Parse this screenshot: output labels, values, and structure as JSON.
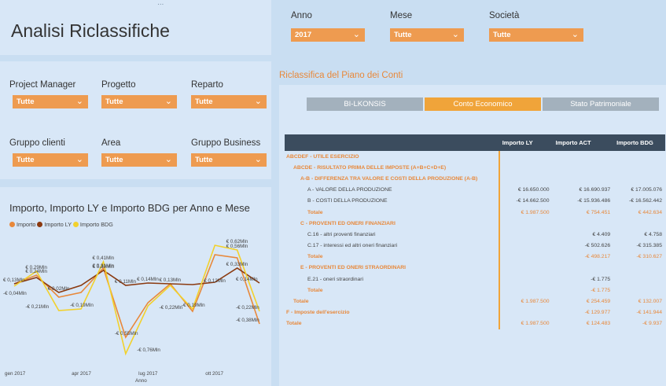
{
  "header": {
    "title": "Analisi Riclassifiche",
    "menu_dots": "∙∙∙"
  },
  "top_filters": [
    {
      "label": "Anno",
      "value": "2017"
    },
    {
      "label": "Mese",
      "value": "Tutte"
    },
    {
      "label": "Società",
      "value": "Tutte"
    }
  ],
  "side_filters": [
    {
      "label": "Project Manager",
      "value": "Tutte"
    },
    {
      "label": "Progetto",
      "value": "Tutte"
    },
    {
      "label": "Reparto",
      "value": "Tutte"
    },
    {
      "label": "Gruppo clienti",
      "value": "Tutte"
    },
    {
      "label": "Area",
      "value": "Tutte"
    },
    {
      "label": "Gruppo Business",
      "value": "Tutte"
    }
  ],
  "section_title": "Riclassifica del Piano dei Conti",
  "tabs": [
    {
      "label": "BI-LKONSIS",
      "active": false
    },
    {
      "label": "Conto Economico",
      "active": true
    },
    {
      "label": "Stato Patrimoniale",
      "active": false
    }
  ],
  "table": {
    "columns": [
      "",
      "Importo LY",
      "Importo ACT",
      "Importo BDG"
    ],
    "rows": [
      {
        "label": "ABCDEF - UTILE ESERCIZIO",
        "indent": 0,
        "style": "orange",
        "ly": "",
        "act": "",
        "bdg": ""
      },
      {
        "label": "ABCDE - RISULTATO PRIMA DELLE IMPOSTE (A+B+C+D+E)",
        "indent": 1,
        "style": "orange",
        "ly": "",
        "act": "",
        "bdg": ""
      },
      {
        "label": "A-B - DIFFERENZA TRA VALORE E COSTI DELLA PRODUZIONE (A-B)",
        "indent": 2,
        "style": "orange",
        "ly": "",
        "act": "",
        "bdg": ""
      },
      {
        "label": "A - VALORE DELLA PRODUZIONE",
        "indent": 3,
        "style": "normal",
        "ly": "€ 16.650.000",
        "act": "€ 16.690.937",
        "bdg": "€ 17.005.076"
      },
      {
        "label": "B - COSTI DELLA PRODUZIONE",
        "indent": 3,
        "style": "normal",
        "ly": "-€ 14.662.500",
        "act": "-€ 15.936.486",
        "bdg": "-€ 16.562.442"
      },
      {
        "label": "Totale",
        "indent": 3,
        "style": "orange",
        "ly": "€ 1.987.500",
        "act": "€ 754.451",
        "bdg": "€ 442.634"
      },
      {
        "label": "C - PROVENTI ED ONERI FINANZIARI",
        "indent": 2,
        "style": "orange",
        "ly": "",
        "act": "",
        "bdg": ""
      },
      {
        "label": "C.16 - altri proventi finanziari",
        "indent": 3,
        "style": "normal",
        "ly": "",
        "act": "€ 4.409",
        "bdg": "€ 4.758"
      },
      {
        "label": "C.17 - interessi ed altri oneri finanziari",
        "indent": 3,
        "style": "normal",
        "ly": "",
        "act": "-€ 502.626",
        "bdg": "-€ 315.385"
      },
      {
        "label": "Totale",
        "indent": 3,
        "style": "orange",
        "ly": "",
        "act": "-€ 498.217",
        "bdg": "-€ 310.627"
      },
      {
        "label": "E - PROVENTI ED ONERI STRAORDINARI",
        "indent": 2,
        "style": "orange",
        "ly": "",
        "act": "",
        "bdg": ""
      },
      {
        "label": "E.21 - oneri straordinari",
        "indent": 3,
        "style": "normal",
        "ly": "",
        "act": "-€ 1.775",
        "bdg": ""
      },
      {
        "label": "Totale",
        "indent": 3,
        "style": "orange",
        "ly": "",
        "act": "-€ 1.775",
        "bdg": ""
      },
      {
        "label": "Totale",
        "indent": 1,
        "style": "orange",
        "ly": "€ 1.987.500",
        "act": "€ 254.459",
        "bdg": "€ 132.007"
      },
      {
        "label": "F - Imposte dell'esercizio",
        "indent": 0,
        "style": "orange",
        "ly": "",
        "act": "-€ 129.977",
        "bdg": "-€ 141.944"
      },
      {
        "label": "Totale",
        "indent": 0,
        "style": "orange",
        "ly": "€ 1.987.500",
        "act": "€ 124.483",
        "bdg": "-€ 9.937"
      }
    ]
  },
  "chart_data": {
    "type": "line",
    "title": "Importo, Importo LY e Importo BDG per Anno e Mese",
    "xlabel": "Anno",
    "x": [
      "gen 2017",
      "feb 2017",
      "mar 2017",
      "apr 2017",
      "mag 2017",
      "giu 2017",
      "lug 2017",
      "ago 2017",
      "set 2017",
      "ott 2017",
      "nov 2017",
      "dic 2017"
    ],
    "x_tick_labels": [
      "gen 2017",
      "apr 2017",
      "lug 2017",
      "ott 2017"
    ],
    "series": [
      {
        "name": "Importo",
        "color": "#e8883a",
        "values": [
          0.13,
          0.24,
          -0.04,
          0.02,
          0.33,
          -0.55,
          -0.11,
          0.13,
          -0.22,
          0.5,
          0.46,
          -0.38
        ]
      },
      {
        "name": "Importo LY",
        "color": "#8b3a10",
        "values": [
          0.13,
          0.21,
          0.02,
          0.11,
          0.3,
          0.11,
          0.14,
          0.13,
          0.12,
          0.15,
          0.33,
          0.14
        ]
      },
      {
        "name": "Importo BDG",
        "color": "#f2d12c",
        "values": [
          0.1,
          0.29,
          -0.21,
          -0.19,
          0.41,
          -0.76,
          -0.15,
          0.11,
          -0.19,
          0.62,
          0.56,
          -0.22
        ]
      }
    ],
    "data_labels": [
      {
        "text": "€ 0,29Mln",
        "x": 1,
        "y": 0.29
      },
      {
        "text": "€ 0,24Mln",
        "x": 1,
        "y": 0.24
      },
      {
        "text": "€ 0,13Mln",
        "x": 0,
        "y": 0.13
      },
      {
        "text": "-€ 0,04Mln",
        "x": 0,
        "y": -0.04
      },
      {
        "text": "€ 0,02Mln",
        "x": 2,
        "y": 0.02
      },
      {
        "text": "-€ 0,19Mln",
        "x": 3,
        "y": -0.19
      },
      {
        "text": "-€ 0,21Mln",
        "x": 1,
        "y": -0.21
      },
      {
        "text": "€ 0,41Mln",
        "x": 4,
        "y": 0.41
      },
      {
        "text": "€ 0,30Mln",
        "x": 4,
        "y": 0.3
      },
      {
        "text": "€ 0,31Mln",
        "x": 4,
        "y": 0.31
      },
      {
        "text": "€ 0,11Mln",
        "x": 5,
        "y": 0.11
      },
      {
        "text": "-€ 0,55Mln",
        "x": 5,
        "y": -0.55
      },
      {
        "text": "-€ 0,76Mln",
        "x": 6,
        "y": -0.76
      },
      {
        "text": "€ 0,14Mln",
        "x": 6,
        "y": 0.14
      },
      {
        "text": "€ 0,13Mln",
        "x": 7,
        "y": 0.13
      },
      {
        "text": "-€ 0,22Mln",
        "x": 7,
        "y": -0.22
      },
      {
        "text": "-€ 0,19Mln",
        "x": 8,
        "y": -0.19
      },
      {
        "text": "€ 0,12Mln",
        "x": 9,
        "y": 0.12
      },
      {
        "text": "€ 0,62Mln",
        "x": 10,
        "y": 0.62
      },
      {
        "text": "€ 0,56Mln",
        "x": 10,
        "y": 0.56
      },
      {
        "text": "€ 0,33Mln",
        "x": 10,
        "y": 0.33
      },
      {
        "text": "€ 0,14Mln",
        "x": 11,
        "y": 0.14
      },
      {
        "text": "-€ 0,22Mln",
        "x": 11,
        "y": -0.22
      },
      {
        "text": "-€ 0,38Mln",
        "x": 11,
        "y": -0.38
      }
    ],
    "ylim": [
      -0.85,
      0.75
    ],
    "legend": "top-left",
    "grid": false
  }
}
